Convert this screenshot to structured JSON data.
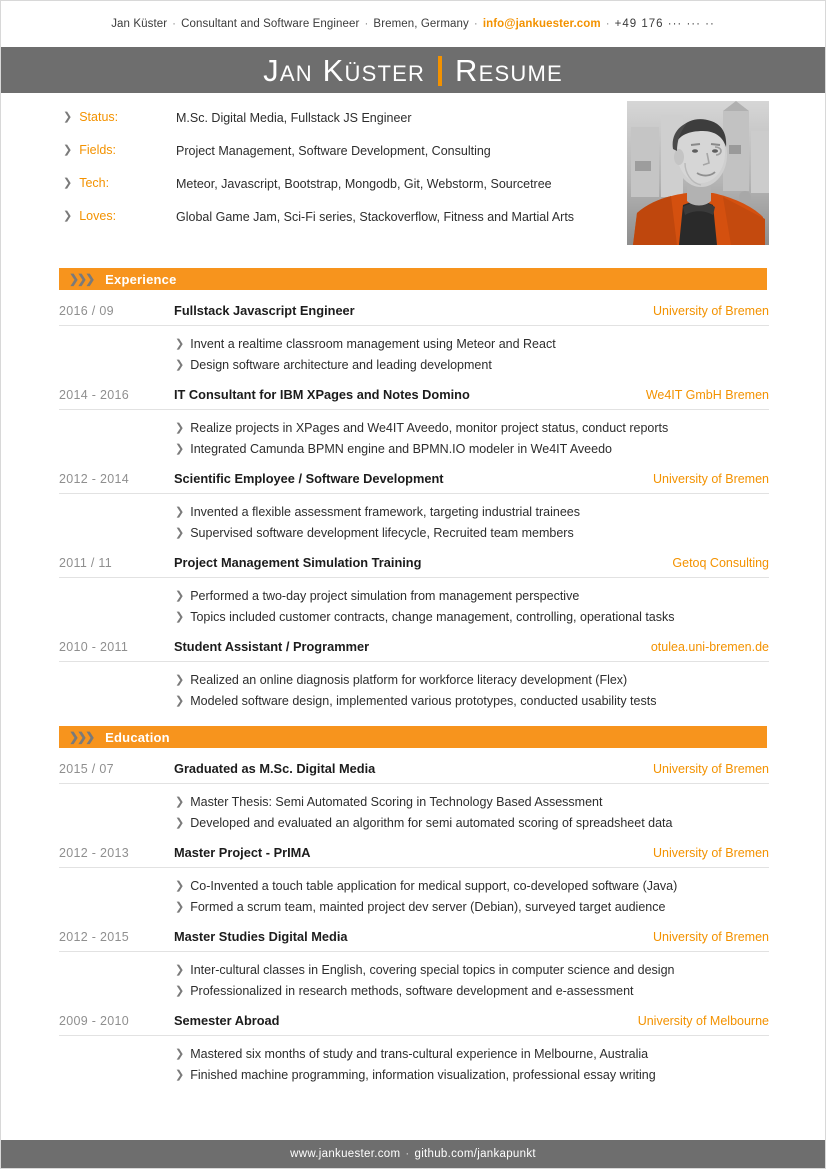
{
  "colors": {
    "accent": "#f39200",
    "section_bar": "#f7941d",
    "bar_gray": "#6e6e6e",
    "text": "#2d2d2d",
    "muted": "#8f8f8f"
  },
  "contact": {
    "name": "Jan Küster",
    "role": "Consultant and Software Engineer",
    "location": "Bremen, Germany",
    "email": "info@jankuester.com",
    "phone": "+49 176 ··· ··· ··",
    "separator": "·"
  },
  "title_bar": {
    "name": "Jan Küster",
    "kind": "Resume"
  },
  "info": {
    "rows": [
      {
        "label": "Status:",
        "value": "M.Sc. Digital Media, Fullstack JS Engineer"
      },
      {
        "label": "Fields:",
        "value": "Project Management, Software Development, Consulting"
      },
      {
        "label": "Tech:",
        "value": "Meteor, Javascript, Bootstrap, Mongodb, Git, Webstorm, Sourcetree"
      },
      {
        "label": "Loves:",
        "value": "Global Game Jam, Sci-Fi series, Stackoverflow, Fitness and Martial Arts"
      }
    ]
  },
  "sections": [
    {
      "title": "Experience",
      "entries": [
        {
          "date": "2016 / 09",
          "title": "Fullstack Javascript Engineer",
          "org": "University of Bremen",
          "points": [
            "Invent a realtime classroom management using Meteor and React",
            "Design software architecture and leading development"
          ]
        },
        {
          "date": "2014 - 2016",
          "title": "IT Consultant for IBM XPages and Notes Domino",
          "org": "We4IT GmbH Bremen",
          "points": [
            "Realize projects in XPages and We4IT Aveedo, monitor project status, conduct reports",
            "Integrated Camunda BPMN engine and BPMN.IO modeler in We4IT Aveedo"
          ]
        },
        {
          "date": "2012 - 2014",
          "title": "Scientific Employee / Software Development",
          "org": "University of Bremen",
          "points": [
            "Invented a flexible assessment framework, targeting industrial trainees",
            "Supervised software development lifecycle, Recruited team members"
          ]
        },
        {
          "date": "2011 / 11",
          "title": "Project Management Simulation Training",
          "org": "Getoq Consulting",
          "points": [
            "Performed a two-day project simulation from management perspective",
            "Topics included customer contracts, change management, controlling, operational tasks"
          ]
        },
        {
          "date": "2010 - 2011",
          "title": "Student Assistant / Programmer",
          "org": "otulea.uni-bremen.de",
          "points": [
            "Realized an online diagnosis platform for workforce literacy development (Flex)",
            "Modeled software design, implemented various prototypes, conducted usability tests"
          ]
        }
      ]
    },
    {
      "title": "Education",
      "entries": [
        {
          "date": "2015 / 07",
          "title": "Graduated as M.Sc. Digital Media",
          "org": "University of Bremen",
          "points": [
            "Master Thesis: Semi Automated Scoring in Technology Based Assessment",
            "Developed and evaluated an algorithm for semi automated scoring of spreadsheet data"
          ]
        },
        {
          "date": "2012 - 2013",
          "title": "Master Project - PrIMA",
          "org": "University of Bremen",
          "points": [
            "Co-Invented a touch table application for medical support, co-developed software (Java)",
            "Formed a scrum team, mainted project dev server (Debian), surveyed target audience"
          ]
        },
        {
          "date": "2012 - 2015",
          "title": "Master Studies Digital Media",
          "org": "University of Bremen",
          "points": [
            "Inter-cultural classes in English, covering special topics in computer science and design",
            "Professionalized in research methods, software development and e-assessment"
          ]
        },
        {
          "date": "2009 - 2010",
          "title": "Semester Abroad",
          "org": "University of Melbourne",
          "points": [
            "Mastered six months of study and trans-cultural experience in Melbourne, Australia",
            "Finished machine programming, information visualization, professional essay writing"
          ]
        }
      ]
    }
  ],
  "footer": {
    "website": "www.jankuester.com",
    "github": "github.com/jankapunkt",
    "separator": "·"
  },
  "icons": {
    "bullet": "❯",
    "section_chevrons": "❯❯❯"
  }
}
